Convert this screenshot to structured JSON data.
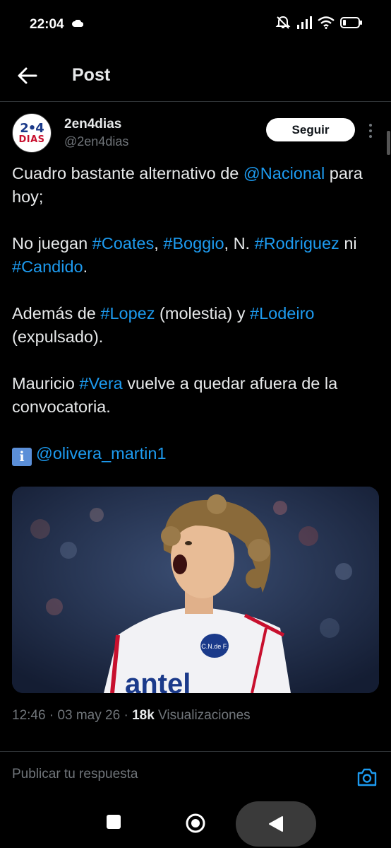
{
  "status_bar": {
    "time": "22:04"
  },
  "header": {
    "title": "Post"
  },
  "author": {
    "name": "2en4dias",
    "handle": "@2en4dias",
    "avatar_top": "2•4",
    "avatar_bottom": "DIAS",
    "follow_label": "Seguir"
  },
  "post": {
    "p1_a": "Cuadro bastante alternativo de ",
    "p1_mention": "@Nacional",
    "p1_b": " para hoy;",
    "p2_a": "No juegan ",
    "p2_tag1": "#Coates",
    "p2_sep1": ", ",
    "p2_tag2": "#Boggio",
    "p2_sep2": ", N. ",
    "p2_tag3": "#Rodriguez",
    "p2_sep3": " ni ",
    "p2_tag4": "#Candido",
    "p2_end": ".",
    "p3_a": "Además de ",
    "p3_tag1": "#Lopez",
    "p3_mid": " (molestia) y ",
    "p3_tag2": "#Lodeiro",
    "p3_end": " (expulsado).",
    "p4_a": "Mauricio ",
    "p4_tag": "#Vera",
    "p4_end": " vuelve a quedar afuera de la convocatoria.",
    "p5_icon": "i",
    "p5_mention": "@olivera_martin1"
  },
  "media": {
    "jersey_text": "antel",
    "badge_text": "C.N.de F."
  },
  "meta": {
    "time": "12:46",
    "sep1": " · ",
    "date": "03 may 26",
    "sep2": " · ",
    "views_count": "18k",
    "views_label": " Visualizaciones"
  },
  "reply": {
    "placeholder": "Publicar tu respuesta"
  },
  "icons": [
    "cloud-icon",
    "mute-icon",
    "signal-icon",
    "wifi-icon",
    "battery-icon",
    "back-arrow-icon",
    "more-vertical-icon",
    "info-icon",
    "camera-icon",
    "nav-recents-icon",
    "nav-home-icon",
    "nav-back-icon"
  ],
  "colors": {
    "accent": "#1d9bf0",
    "background": "#000000",
    "text": "#e7e9ea",
    "muted": "#71767b"
  }
}
